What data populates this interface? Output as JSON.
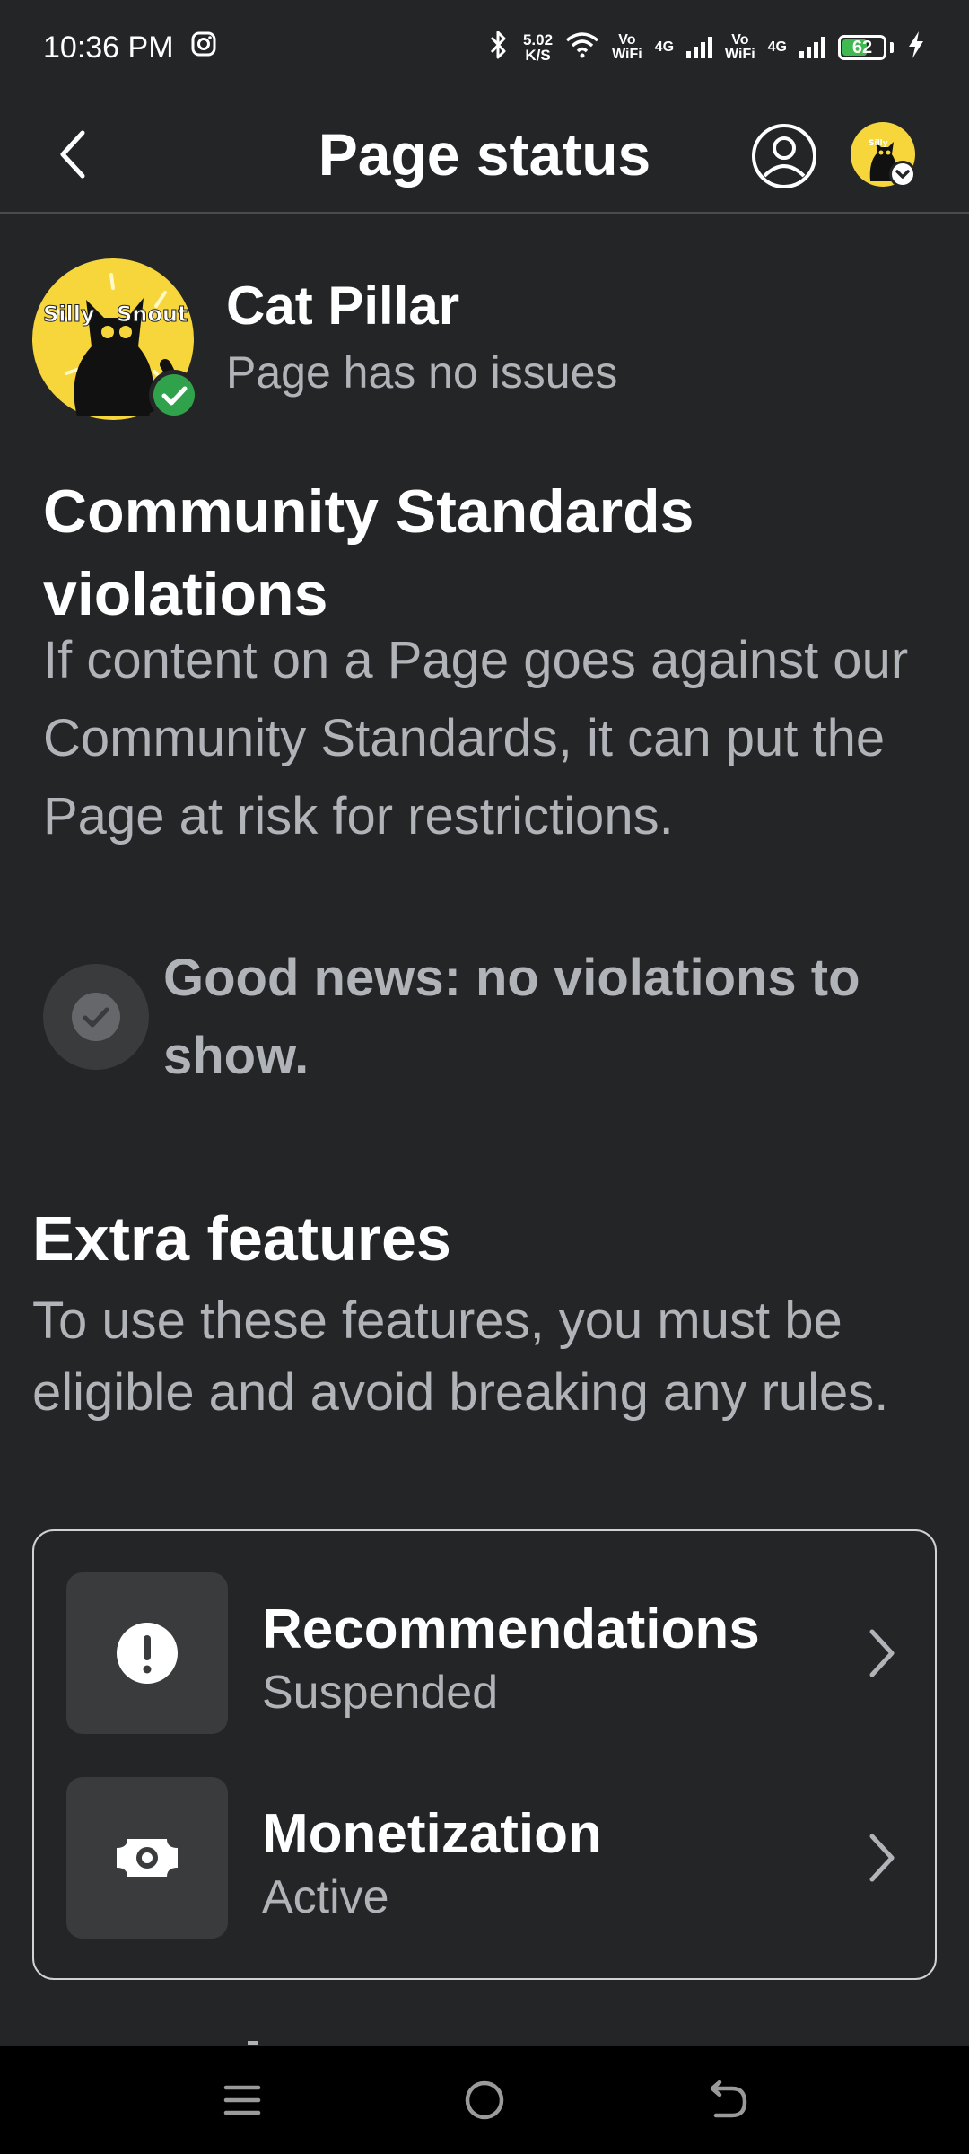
{
  "status_bar": {
    "time": "10:36 PM",
    "net_speed_value": "5.02",
    "net_speed_unit": "K/S",
    "vowifi_label_1": "Vo",
    "vowifi_label_2": "WiFi",
    "network_type": "4G",
    "battery_level": "62",
    "battery_fraction": 0.62,
    "icons": [
      "instagram-icon",
      "bluetooth-icon",
      "wifi-icon",
      "signal-icon",
      "battery-icon",
      "charging-icon"
    ]
  },
  "header": {
    "title": "Page status",
    "icons": [
      "back-arrow-icon",
      "profile-icon",
      "page-switcher-avatar",
      "chevron-down-icon"
    ]
  },
  "page": {
    "name": "Cat Pillar",
    "status": "Page has no issues",
    "avatar_text_1": "Silly",
    "avatar_text_2": "Snout"
  },
  "community_standards": {
    "title": "Community Standards violations",
    "description": "If content on a Page goes against our Community Standards, it can put the Page at risk for restrictions.",
    "good_news": "Good news: no violations to show."
  },
  "extra_features": {
    "title": "Extra features",
    "description": "To use these features, you must be eligible and avoid breaking any rules.",
    "items": [
      {
        "title": "Recommendations",
        "status": "Suspended",
        "icon": "alert-icon"
      },
      {
        "title": "Monetization",
        "status": "Active",
        "icon": "money-icon"
      }
    ]
  },
  "nav_bar": {
    "icons": [
      "menu-icon",
      "home-icon",
      "back-icon"
    ]
  },
  "colors": {
    "background": "#242526",
    "text_primary": "#ffffff",
    "text_secondary": "#b0b3b8",
    "icon_box": "#3a3b3c",
    "verified_green": "#31a24c",
    "avatar_yellow": "#f7d63c",
    "battery_green": "#3fb950"
  }
}
